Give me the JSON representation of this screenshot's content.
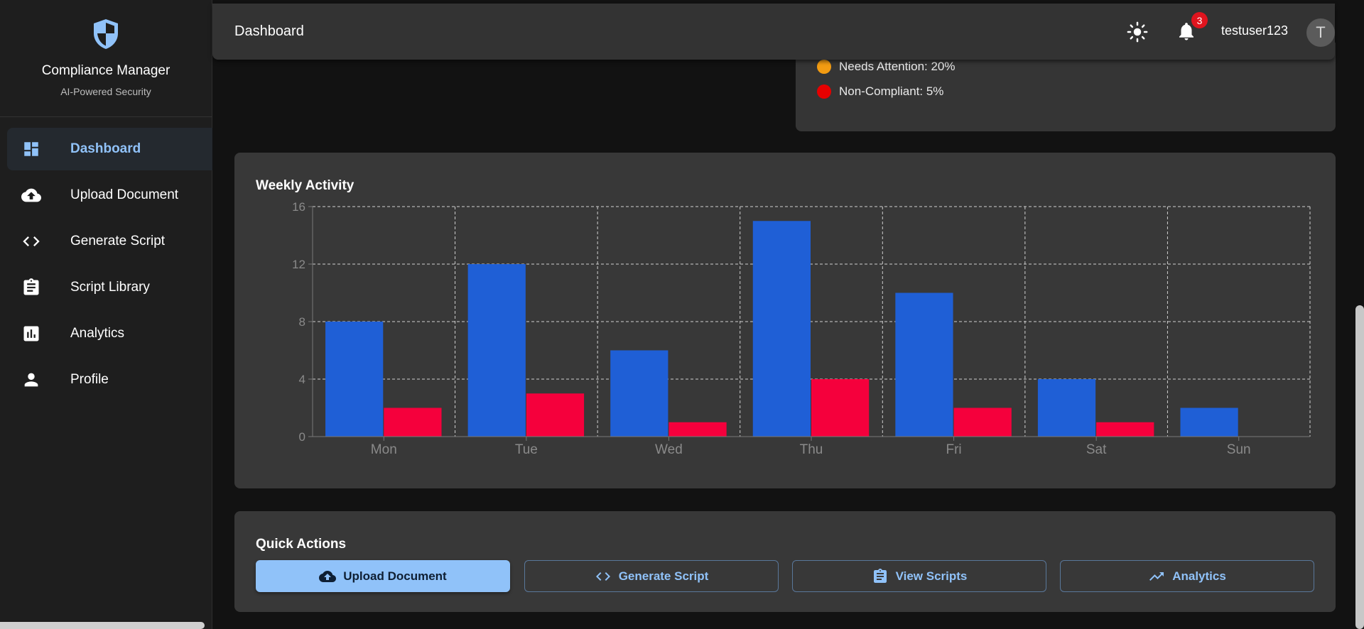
{
  "sidebar": {
    "brand_title": "Compliance Manager",
    "brand_subtitle": "AI-Powered Security",
    "items": [
      {
        "label": "Dashboard",
        "icon": "dashboard-icon",
        "active": true
      },
      {
        "label": "Upload Document",
        "icon": "cloud-upload-icon"
      },
      {
        "label": "Generate Script",
        "icon": "code-icon"
      },
      {
        "label": "Script Library",
        "icon": "clipboard-icon"
      },
      {
        "label": "Analytics",
        "icon": "bar-chart-icon"
      },
      {
        "label": "Profile",
        "icon": "person-icon"
      }
    ]
  },
  "header": {
    "title": "Dashboard",
    "notification_count": "3",
    "username": "testuser123",
    "avatar_initial": "T"
  },
  "status": {
    "needs_attention": "Needs Attention: 20%",
    "non_compliant": "Non-Compliant: 5%",
    "needs_attention_color": "#f39c12",
    "non_compliant_color": "#e60000"
  },
  "weekly": {
    "title": "Weekly Activity"
  },
  "chart_data": {
    "type": "bar",
    "categories": [
      "Mon",
      "Tue",
      "Wed",
      "Thu",
      "Fri",
      "Sat",
      "Sun"
    ],
    "series": [
      {
        "values": [
          8,
          12,
          6,
          15,
          10,
          4,
          2
        ],
        "color": "#1f5fd6"
      },
      {
        "values": [
          2,
          3,
          1,
          4,
          2,
          1,
          0
        ],
        "color": "#f5003c"
      }
    ],
    "ylim": [
      0,
      16
    ],
    "yticks": [
      0,
      4,
      8,
      12,
      16
    ],
    "grid": true
  },
  "quick_actions": {
    "title": "Quick Actions",
    "buttons": [
      {
        "label": "Upload Document",
        "icon": "cloud-upload-icon"
      },
      {
        "label": "Generate Script",
        "icon": "code-icon"
      },
      {
        "label": "View Scripts",
        "icon": "clipboard-icon"
      },
      {
        "label": "Analytics",
        "icon": "trending-up-icon"
      }
    ]
  },
  "colors": {
    "accent": "#90c2f9",
    "bar_primary": "#1f5fd6",
    "bar_secondary": "#f5003c"
  }
}
